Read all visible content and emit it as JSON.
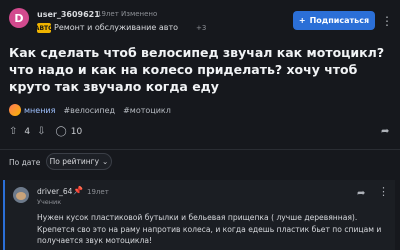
{
  "post": {
    "author": {
      "avatar_letter": "D",
      "username": "user_3609621",
      "meta": "19лет Изменено"
    },
    "category": {
      "icon_label": "АВТО",
      "label": "Ремонт и обслуживание авто",
      "extra": "+3"
    },
    "subscribe_label": "Подписаться",
    "question": "Как сделать чтоб велосипед звучал как мотоцикл? что надо и как на колесо приделать? хочу чтоб круто так звучало когда еду",
    "tags": {
      "mneniya": "мнения",
      "tag1": "#велосипед",
      "tag2": "#мотоцикл"
    },
    "votes": "4",
    "comments_count": "10"
  },
  "sort": {
    "label": "По дате",
    "selected": "По рейтингу"
  },
  "answer": {
    "author": "driver_64",
    "age": "19лет",
    "rank": "Ученик",
    "text": "Нужен кусок пластиковой бутылки и бельевая прищепка ( лучше деревянная). Крепется сво это на раму напротив колеса, и когда едешь пластик бьет по спицам и получается звук мотоцикла!"
  },
  "icons": {
    "more": "more-horizontal-icon",
    "plus": "plus-icon",
    "upvote": "arrow-up-icon",
    "downvote": "arrow-down-icon",
    "comments": "comment-icon",
    "share": "share-icon",
    "pin": "pin-icon"
  },
  "colors": {
    "accent": "#2b6fd7",
    "avatar": "#d24a8e",
    "category_icon": "#f0b400"
  }
}
